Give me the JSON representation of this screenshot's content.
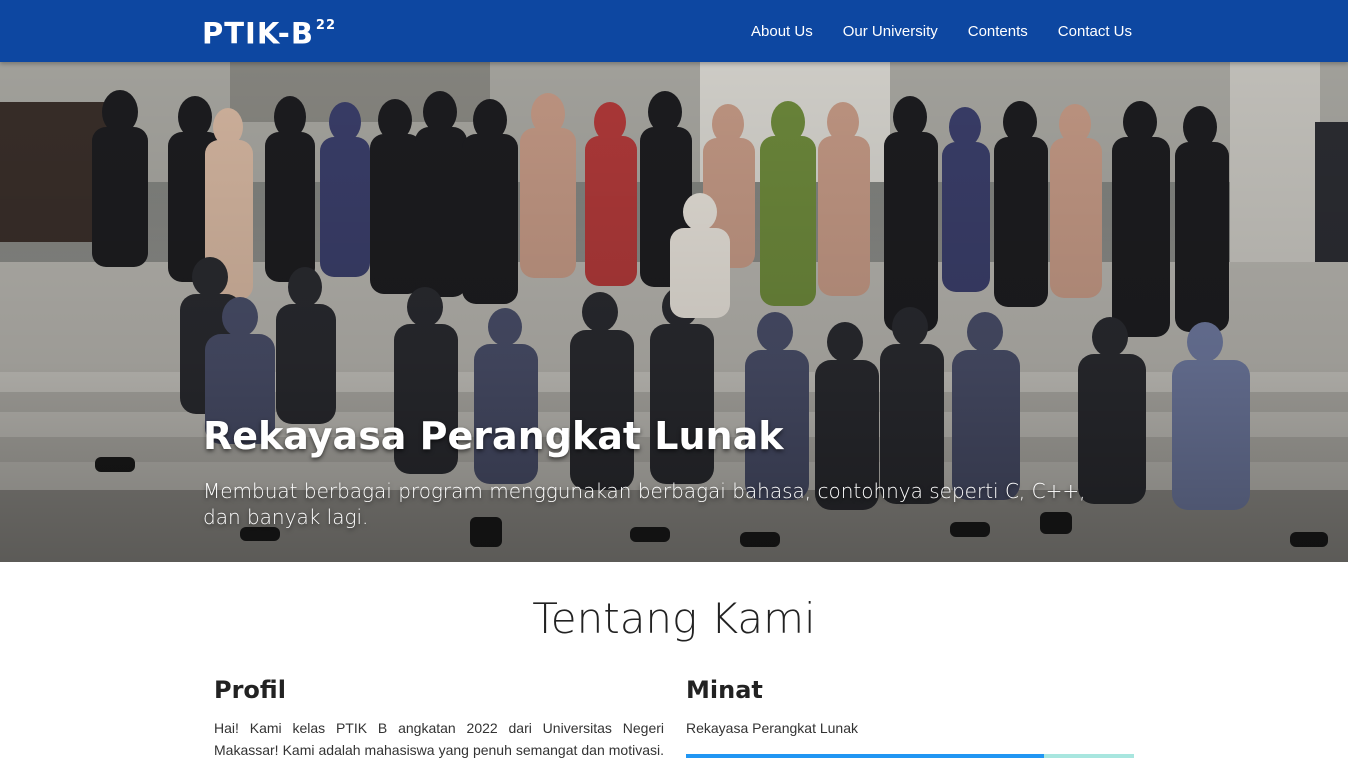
{
  "navbar": {
    "brand": "PTIK-B",
    "brand_sup": "22",
    "links": [
      "About Us",
      "Our University",
      "Contents",
      "Contact Us"
    ]
  },
  "hero": {
    "title": "Rekayasa Perangkat Lunak",
    "subtitle": "Membuat berbagai program menggunakan berbagai bahasa, contohnya seperti C, C++, dan banyak lagi."
  },
  "about": {
    "title": "Tentang Kami",
    "profile": {
      "title": "Profil",
      "text": "Hai! Kami kelas PTIK B angkatan 2022 dari Universitas Negeri Makassar! Kami adalah mahasiswa yang penuh semangat dan motivasi. Kami"
    },
    "interest": {
      "title": "Minat",
      "skill_label": "Rekayasa Perangkat Lunak",
      "skill_level": 0.8
    }
  },
  "colors": {
    "navbar": "#0d47a1",
    "skill_fill": "#2196f3",
    "skill_track": "#a8e6df"
  }
}
